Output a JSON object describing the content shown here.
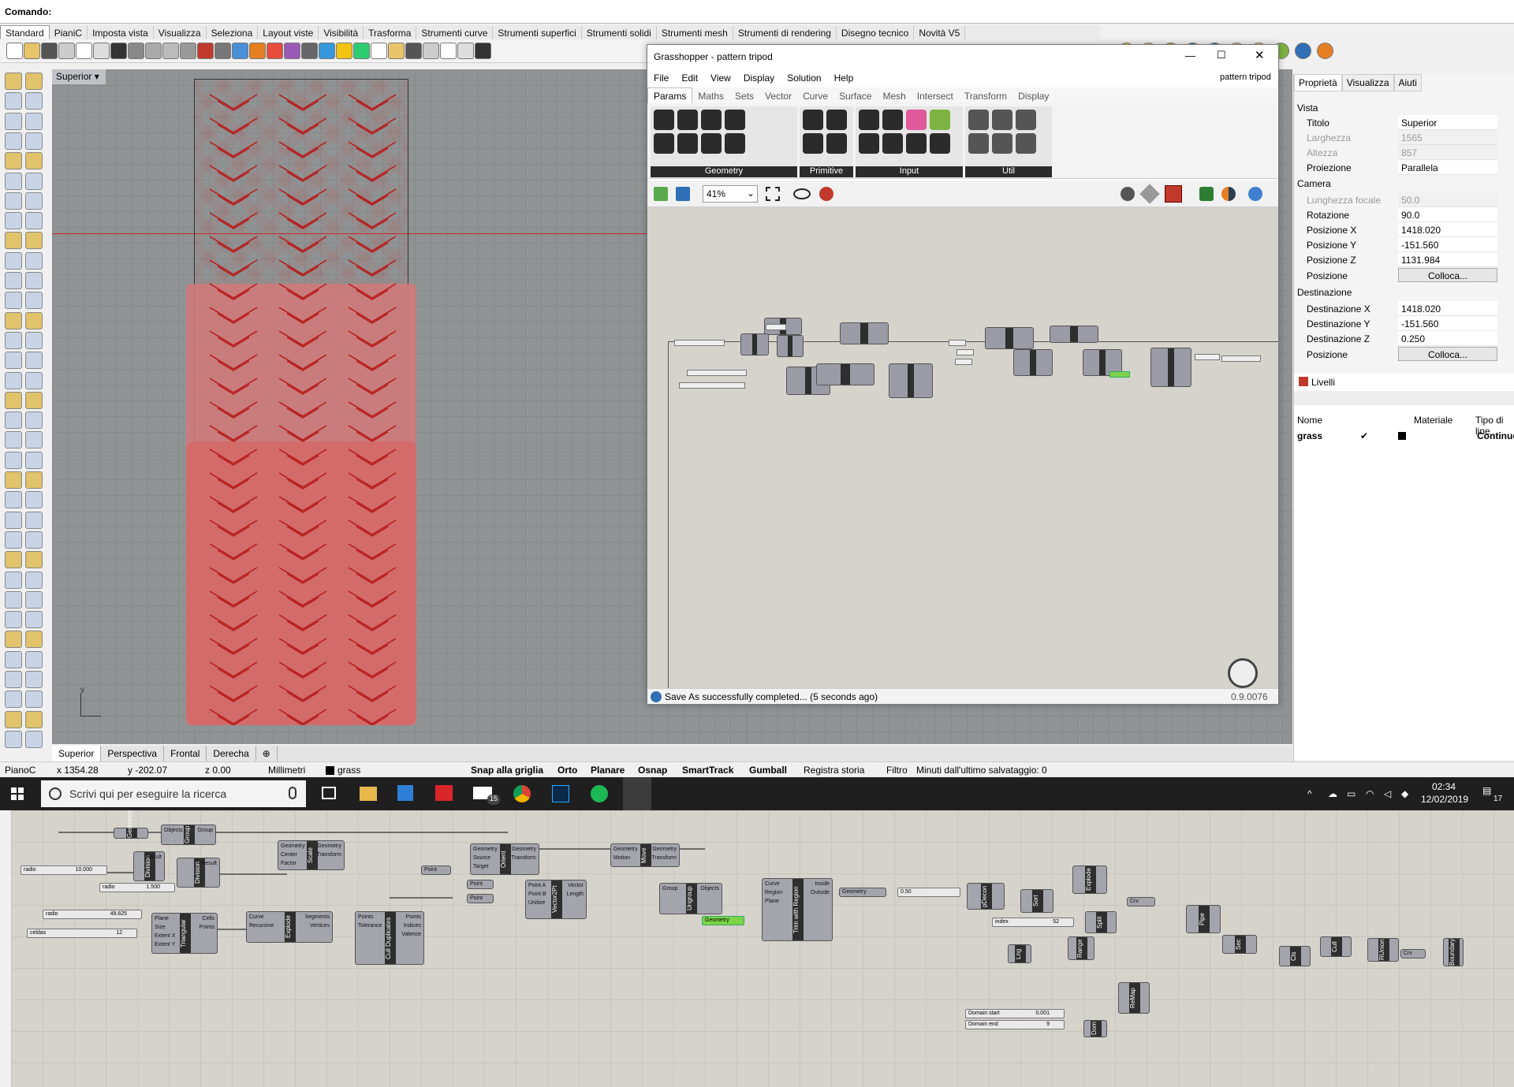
{
  "command": {
    "label": "Comando:"
  },
  "tabs": [
    "Standard",
    "PianiC",
    "Imposta vista",
    "Visualizza",
    "Seleziona",
    "Layout viste",
    "Visibilità",
    "Trasforma",
    "Strumenti curve",
    "Strumenti superfici",
    "Strumenti solidi",
    "Strumenti mesh",
    "Strumenti di rendering",
    "Disegno tecnico",
    "Novità V5"
  ],
  "viewport": {
    "label": "Superior",
    "axis_y": "y"
  },
  "view_tabs": [
    "Superior",
    "Perspectiva",
    "Frontal",
    "Derecha"
  ],
  "status": {
    "plane": "PianoC",
    "x": "x 1354.28",
    "y": "y -202.07",
    "z": "z 0.00",
    "units": "Millimetri",
    "layer": "grass",
    "snap": "Snap alla griglia",
    "ortho": "Orto",
    "planar": "Planare",
    "osnap": "Osnap",
    "smarttrack": "SmartTrack",
    "gumball": "Gumball",
    "history": "Registra storia",
    "filter": "Filtro",
    "saved": "Minuti dall'ultimo salvataggio: 0"
  },
  "taskbar": {
    "search_placeholder": "Scrivi qui per eseguire la ricerca",
    "time": "02:34",
    "date": "12/02/2019",
    "mail_badge": "15",
    "notif_badge": "17"
  },
  "grasshopper": {
    "title": "Grasshopper - pattern tripod",
    "doc_name": "pattern tripod",
    "menu": [
      "File",
      "Edit",
      "View",
      "Display",
      "Solution",
      "Help"
    ],
    "tabs": [
      "Params",
      "Maths",
      "Sets",
      "Vector",
      "Curve",
      "Surface",
      "Mesh",
      "Intersect",
      "Transform",
      "Display"
    ],
    "groups": [
      "Geometry",
      "Primitive",
      "Input",
      "Util"
    ],
    "zoom": "41%",
    "status": "Save As successfully completed... (5 seconds ago)",
    "version": "0.9.0076"
  },
  "properties": {
    "tabs": [
      "Proprietà",
      "Visualizza",
      "Aiuti"
    ],
    "section_view": "Vista",
    "rows_view": [
      {
        "k": "Titolo",
        "v": "Superior",
        "dis": false
      },
      {
        "k": "Larghezza",
        "v": "1565",
        "dis": true
      },
      {
        "k": "Altezza",
        "v": "857",
        "dis": true
      },
      {
        "k": "Proiezione",
        "v": "Parallela",
        "dis": false
      }
    ],
    "section_camera": "Camera",
    "rows_camera": [
      {
        "k": "Lunghezza focale",
        "v": "50.0",
        "dis": true
      },
      {
        "k": "Rotazione",
        "v": "90.0",
        "dis": false
      },
      {
        "k": "Posizione X",
        "v": "1418.020",
        "dis": false
      },
      {
        "k": "Posizione Y",
        "v": "-151.560",
        "dis": false
      },
      {
        "k": "Posizione Z",
        "v": "1131.984",
        "dis": false
      }
    ],
    "place_label": "Posizione",
    "place_button": "Colloca...",
    "section_target": "Destinazione",
    "rows_target": [
      {
        "k": "Destinazione X",
        "v": "1418.020",
        "dis": false
      },
      {
        "k": "Destinazione Y",
        "v": "-151.560",
        "dis": false
      },
      {
        "k": "Destinazione Z",
        "v": "0.250",
        "dis": false
      }
    ]
  },
  "layers": {
    "title": "Livelli",
    "cols": [
      "Nome",
      "Materiale",
      "Tipo di line"
    ],
    "row": {
      "name": "grass",
      "check": "✔",
      "linetype": "Continuo"
    }
  },
  "bottom_nodes": {
    "group": "Group",
    "group_in": "Objects",
    "group_out": "Group",
    "geom": "Geometry",
    "div1": "Division",
    "div2": "Division",
    "scale": "Scale",
    "scale_in": [
      "Geometry",
      "Center",
      "Factor"
    ],
    "scale_out": [
      "Geometry",
      "Transform"
    ],
    "orient": "Orient",
    "orient_in": [
      "Geometry",
      "Source",
      "Target"
    ],
    "orient_out": [
      "Geometry",
      "Transform"
    ],
    "move": "Move",
    "move_in": [
      "Geometry",
      "Motion"
    ],
    "move_out": [
      "Geometry",
      "Transform"
    ],
    "tri": "Triangular",
    "tri_in": [
      "Plane",
      "Size",
      "Extent X",
      "Extent Y"
    ],
    "tri_out": [
      "Cells",
      "Points"
    ],
    "explode": "Explode",
    "explode_in": [
      "Curve",
      "Recursive"
    ],
    "explode_out": [
      "Segments",
      "Vertices"
    ],
    "cull": "Cull Duplicates",
    "cull_in": [
      "Points",
      "Tolerance"
    ],
    "cull_out": [
      "Points",
      "Indices",
      "Valence"
    ],
    "vec": "Vector2Pt",
    "vec_in": [
      "Point A",
      "Point B",
      "Unitize"
    ],
    "vec_out": [
      "Vector",
      "Length"
    ],
    "ungroup": "Ungroup",
    "ungroup_in": "Group",
    "ungroup_out": "Objects",
    "trim": "Trim with Region",
    "trim_in": [
      "Curve",
      "Region",
      "Plane"
    ],
    "trim_out": [
      "Inside",
      "Outside"
    ],
    "green": "Geometry",
    "geom_param": "Geometry",
    "num": "0.50",
    "pdecon": "pDecon",
    "sort": "Sort",
    "explode2": "Explode",
    "split": "Split",
    "pipe": "Pipe",
    "crv": "Crv",
    "crv2": "Crv",
    "ratio": "radio",
    "ratio_val": "10.000",
    "radio2": "radio",
    "radio2_val": "1.500",
    "radio3": "radio",
    "radio3_val": "49.825",
    "celdas": "celdas",
    "celdas_val": "12",
    "point": "Point",
    "point_a": "Point",
    "point_b": "Point",
    "index": "index",
    "index_val": "52",
    "lng": "Lng",
    "range": "Range",
    "remap": "ReMap",
    "dom": "Dom",
    "dstart": "Domain start",
    "dstart_val": "0.001",
    "dend": "Domain end",
    "dend_val": "9",
    "sec": "Sec",
    "cls": "Cls",
    "cull2": "Cull",
    "runion": "RUnion",
    "crv3": "Crv",
    "boundary": "Boundary",
    "division_result": "Result"
  }
}
